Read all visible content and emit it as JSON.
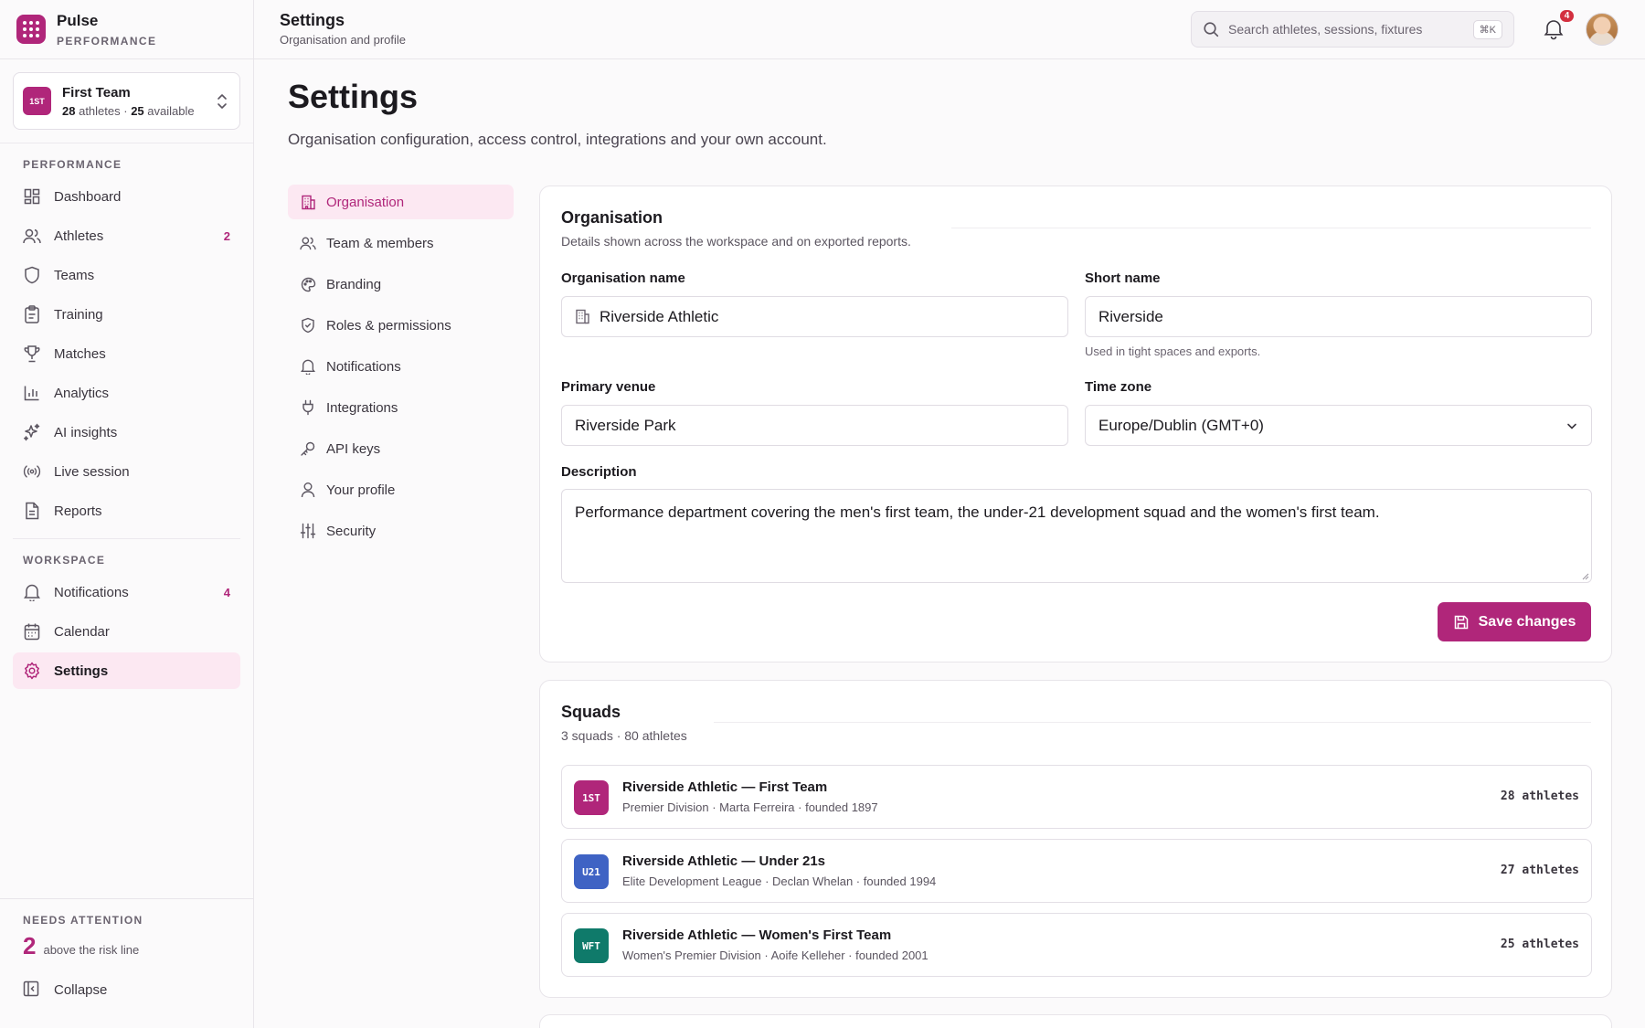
{
  "brand": {
    "name": "Pulse",
    "subtitle": "PERFORMANCE"
  },
  "team_switcher": {
    "badge": "1ST",
    "name": "First Team",
    "athletes_count": "28",
    "athletes_label": "athletes ·",
    "available_count": "25",
    "available_label": "available"
  },
  "sidebar": {
    "performance_heading": "PERFORMANCE",
    "performance_items": [
      {
        "label": "Dashboard",
        "icon": "dashboard-icon"
      },
      {
        "label": "Athletes",
        "icon": "users-icon",
        "count": "2"
      },
      {
        "label": "Teams",
        "icon": "shield-icon"
      },
      {
        "label": "Training",
        "icon": "clipboard-icon"
      },
      {
        "label": "Matches",
        "icon": "trophy-icon"
      },
      {
        "label": "Analytics",
        "icon": "bar-chart-icon"
      },
      {
        "label": "AI insights",
        "icon": "sparkles-icon"
      },
      {
        "label": "Live session",
        "icon": "broadcast-icon"
      },
      {
        "label": "Reports",
        "icon": "document-icon"
      }
    ],
    "workspace_heading": "WORKSPACE",
    "workspace_items": [
      {
        "label": "Notifications",
        "icon": "bell-icon",
        "count": "4"
      },
      {
        "label": "Calendar",
        "icon": "calendar-icon"
      },
      {
        "label": "Settings",
        "icon": "gear-icon",
        "active": true
      }
    ],
    "attention": {
      "heading": "NEEDS ATTENTION",
      "count": "2",
      "text": "above the risk line"
    },
    "collapse_label": "Collapse"
  },
  "topbar": {
    "title": "Settings",
    "subtitle": "Organisation and profile",
    "search_placeholder": "Search athletes, sessions, fixtures",
    "search_shortcut": "⌘K",
    "notification_count": "4"
  },
  "page": {
    "title": "Settings",
    "subtitle": "Organisation configuration, access control, integrations and your own account."
  },
  "settings_nav": [
    {
      "label": "Organisation",
      "icon": "building-icon",
      "active": true
    },
    {
      "label": "Team & members",
      "icon": "users-icon"
    },
    {
      "label": "Branding",
      "icon": "palette-icon"
    },
    {
      "label": "Roles & permissions",
      "icon": "shield-check-icon"
    },
    {
      "label": "Notifications",
      "icon": "bell-icon"
    },
    {
      "label": "Integrations",
      "icon": "plug-icon"
    },
    {
      "label": "API keys",
      "icon": "key-icon"
    },
    {
      "label": "Your profile",
      "icon": "user-icon"
    },
    {
      "label": "Security",
      "icon": "sliders-icon"
    }
  ],
  "organisation": {
    "title": "Organisation",
    "description": "Details shown across the workspace and on exported reports.",
    "org_name_label": "Organisation name",
    "org_name_value": "Riverside Athletic",
    "short_name_label": "Short name",
    "short_name_value": "Riverside",
    "short_name_hint": "Used in tight spaces and exports.",
    "venue_label": "Primary venue",
    "venue_value": "Riverside Park",
    "timezone_label": "Time zone",
    "timezone_value": "Europe/Dublin (GMT+0)",
    "description_label": "Description",
    "description_value": "Performance department covering the men's first team, the under-21 development squad and the women's first team.",
    "save_label": "Save changes"
  },
  "squads": {
    "title": "Squads",
    "summary": "3 squads · 80 athletes",
    "items": [
      {
        "badge": "1ST",
        "color": "#b0267a",
        "name": "Riverside Athletic — First Team",
        "meta": "Premier Division · Marta Ferreira · founded 1897",
        "count": "28 athletes"
      },
      {
        "badge": "U21",
        "color": "#3f63c4",
        "name": "Riverside Athletic — Under 21s",
        "meta": "Elite Development League · Declan Whelan · founded 1994",
        "count": "27 athletes"
      },
      {
        "badge": "WFT",
        "color": "#0f7a6a",
        "name": "Riverside Athletic — Women's First Team",
        "meta": "Women's Premier Division · Aoife Kelleher · founded 2001",
        "count": "25 athletes"
      }
    ]
  },
  "colors": {
    "accent": "#b0267a",
    "accent_soft": "#fce8f2",
    "alert": "#d32f3f"
  }
}
